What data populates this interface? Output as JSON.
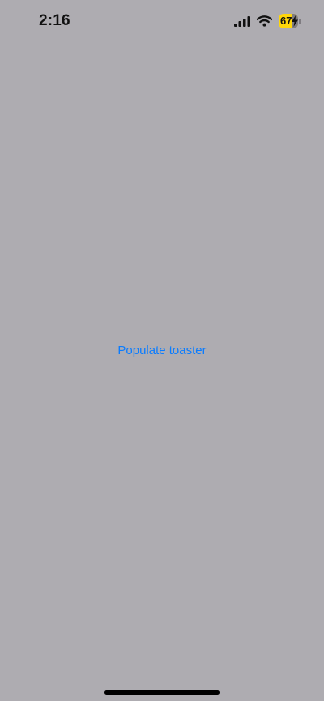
{
  "status_bar": {
    "time": "2:16",
    "battery_level": "67",
    "battery_color": "#ffd60a",
    "signal_icon": "cellular-signal-icon",
    "wifi_icon": "wifi-icon",
    "charging_icon": "lightning-bolt-icon"
  },
  "main": {
    "button_label": "Populate toaster",
    "button_color": "#0a7cff"
  }
}
